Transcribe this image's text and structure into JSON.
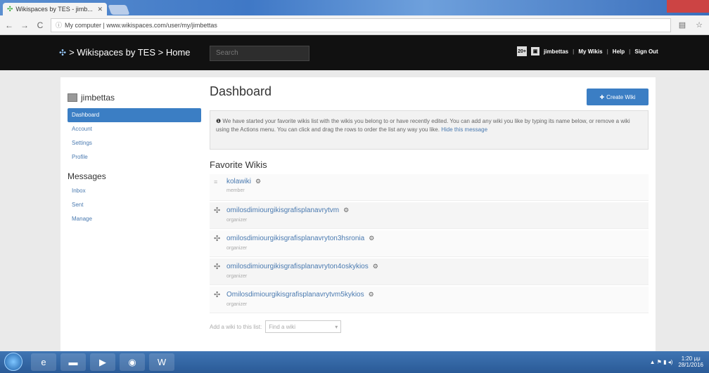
{
  "browser": {
    "tab_title": "Wikispaces by TES - jimb...",
    "url_prefix": "ⓘ",
    "url_host": "www.wikispaces.com",
    "url_text": "My computer | www.wikispaces.com/user/my/jimbettas"
  },
  "site": {
    "brand": "> Wikispaces by TES > Home",
    "search_placeholder": "Search",
    "nav": [
      "jimbettas",
      "My Wikis",
      "Help",
      "Sign Out"
    ]
  },
  "sidebar": {
    "username": "jimbettas",
    "items": [
      {
        "label": "Dashboard",
        "active": true
      },
      {
        "label": "Account"
      },
      {
        "label": "Settings"
      },
      {
        "label": "Profile"
      }
    ],
    "messages_heading": "Messages",
    "messages": [
      {
        "label": "Inbox"
      },
      {
        "label": "Sent"
      },
      {
        "label": "Manage"
      }
    ]
  },
  "main": {
    "title": "Dashboard",
    "create_button": "Create Wiki",
    "notice": "We have started your favorite wikis list with the wikis you belong to or have recently edited. You can add any wiki you like by typing its name below, or remove a wiki using the Actions menu. You can click and drag the rows to order the list any way you like.",
    "notice_hide": "Hide this message",
    "favorites_title": "Favorite Wikis",
    "wikis": [
      {
        "name": "kolawiki",
        "role": "member"
      },
      {
        "name": "omilosdimiourgikisgrafisplanavrytvm",
        "role": "organizer"
      },
      {
        "name": "omilosdimiourgikisgrafisplanavryton3hsronia",
        "role": "organizer"
      },
      {
        "name": "omilosdimiourgikisgrafisplanavryton4oskykios",
        "role": "organizer"
      },
      {
        "name": "Omilosdimiourgikisgrafisplanavrytvm5kykios",
        "role": "organizer"
      }
    ],
    "add_label": "Add a wiki to this list:",
    "find_placeholder": "Find a wiki"
  },
  "taskbar": {
    "time": "1:20 μμ",
    "date": "28/1/2016"
  },
  "colors": {
    "accent": "#3b7ec4",
    "topbar": "#111111",
    "link": "#4a7ab0"
  }
}
